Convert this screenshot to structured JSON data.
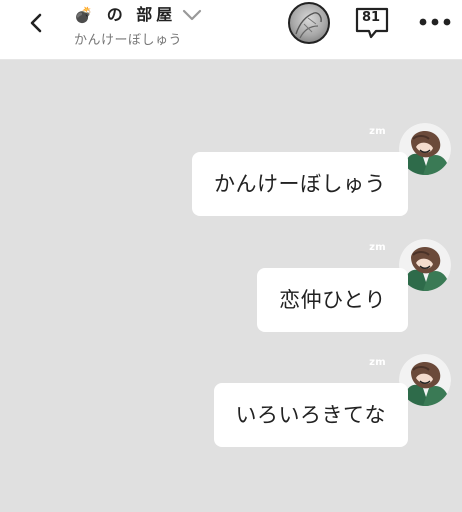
{
  "header": {
    "title_icon": "💣",
    "title": "の 部屋",
    "subtitle": "かんけーぼしゅう",
    "count": "81"
  },
  "icons": {
    "back": "back-chevron-icon",
    "caret": "chevron-down-icon",
    "count": "speech-bubble-icon",
    "more": "more-horizontal-icon"
  },
  "messages": [
    {
      "name": "zm",
      "text": "かんけーぼしゅう"
    },
    {
      "name": "zm",
      "text": "恋仲ひとり"
    },
    {
      "name": "zm",
      "text": "いろいろきてな"
    }
  ],
  "colors": {
    "background": "#e0e0e0",
    "bubble": "#ffffff",
    "text": "#222222",
    "subtitle": "#777777"
  }
}
